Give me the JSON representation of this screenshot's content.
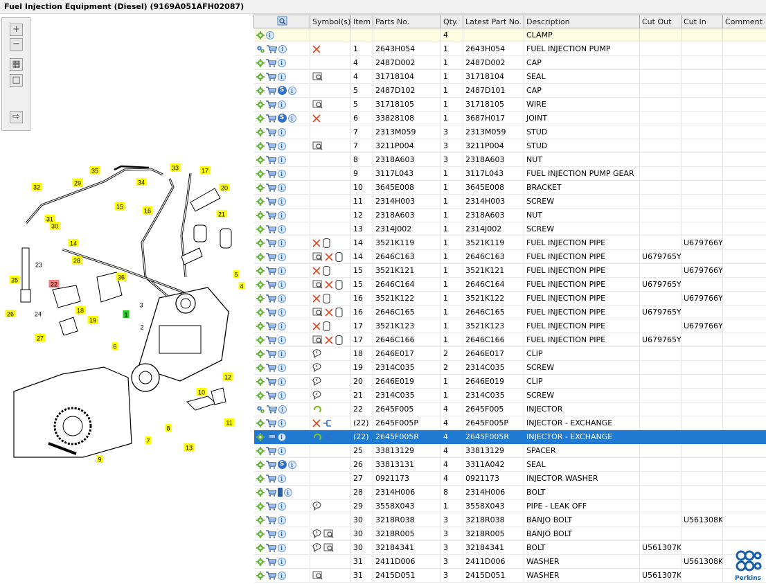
{
  "title": "Fuel Injection Equipment (Diesel) (9169A051AFH02087)",
  "toolbar": {
    "zoom_in": "+",
    "zoom_out": "−",
    "fit": "▦",
    "frame": "□",
    "export": "⇨"
  },
  "table": {
    "headers": [
      "",
      "Symbol(s)",
      "Item",
      "Parts No.",
      "Qty.",
      "Latest Part No.",
      "Description",
      "Cut Out",
      "Cut In",
      "Comment"
    ],
    "rows": [
      {
        "a": [
          "gear",
          "info"
        ],
        "s": [],
        "item": "",
        "part": "",
        "qty": "4",
        "latest": "",
        "desc": "CLAMP",
        "cutout": "",
        "cutin": "",
        "comment": ""
      },
      {
        "a": [
          "gears",
          "cart",
          "info"
        ],
        "s": [
          "x"
        ],
        "item": "1",
        "part": "2643H054",
        "qty": "1",
        "latest": "2643H054",
        "desc": "FUEL INJECTION PUMP",
        "cutout": "",
        "cutin": "",
        "comment": ""
      },
      {
        "a": [
          "gear",
          "cart",
          "info"
        ],
        "s": [],
        "item": "4",
        "part": "2487D002",
        "qty": "1",
        "latest": "2487D002",
        "desc": "CAP",
        "cutout": "",
        "cutin": "",
        "comment": ""
      },
      {
        "a": [
          "gear",
          "cart",
          "info"
        ],
        "s": [
          "view"
        ],
        "item": "4",
        "part": "31718104",
        "qty": "1",
        "latest": "31718104",
        "desc": "SEAL",
        "cutout": "",
        "cutin": "",
        "comment": ""
      },
      {
        "a": [
          "gear",
          "cart",
          "s",
          "info"
        ],
        "s": [],
        "item": "5",
        "part": "2487D102",
        "qty": "1",
        "latest": "2487D101",
        "desc": "CAP",
        "cutout": "",
        "cutin": "",
        "comment": ""
      },
      {
        "a": [
          "gear",
          "cart",
          "info"
        ],
        "s": [
          "view"
        ],
        "item": "5",
        "part": "31718105",
        "qty": "1",
        "latest": "31718105",
        "desc": "WIRE",
        "cutout": "",
        "cutin": "",
        "comment": ""
      },
      {
        "a": [
          "gear",
          "cart",
          "s",
          "info"
        ],
        "s": [
          "x"
        ],
        "item": "6",
        "part": "33828108",
        "qty": "1",
        "latest": "3687H017",
        "desc": "JOINT",
        "cutout": "",
        "cutin": "",
        "comment": ""
      },
      {
        "a": [
          "gear",
          "cart",
          "info"
        ],
        "s": [],
        "item": "7",
        "part": "2313M059",
        "qty": "3",
        "latest": "2313M059",
        "desc": "STUD",
        "cutout": "",
        "cutin": "",
        "comment": ""
      },
      {
        "a": [
          "gear",
          "cart",
          "info"
        ],
        "s": [
          "view"
        ],
        "item": "7",
        "part": "3211P004",
        "qty": "3",
        "latest": "3211P004",
        "desc": "STUD",
        "cutout": "",
        "cutin": "",
        "comment": ""
      },
      {
        "a": [
          "gear",
          "cart",
          "info"
        ],
        "s": [],
        "item": "8",
        "part": "2318A603",
        "qty": "3",
        "latest": "2318A603",
        "desc": "NUT",
        "cutout": "",
        "cutin": "",
        "comment": ""
      },
      {
        "a": [
          "gear",
          "cart",
          "info"
        ],
        "s": [],
        "item": "9",
        "part": "3117L043",
        "qty": "1",
        "latest": "3117L043",
        "desc": "FUEL INJECTION PUMP GEAR",
        "cutout": "",
        "cutin": "",
        "comment": ""
      },
      {
        "a": [
          "gear",
          "cart",
          "info"
        ],
        "s": [],
        "item": "10",
        "part": "3645E008",
        "qty": "1",
        "latest": "3645E008",
        "desc": "BRACKET",
        "cutout": "",
        "cutin": "",
        "comment": ""
      },
      {
        "a": [
          "gear",
          "cart",
          "info"
        ],
        "s": [],
        "item": "11",
        "part": "2314H003",
        "qty": "1",
        "latest": "2314H003",
        "desc": "SCREW",
        "cutout": "",
        "cutin": "",
        "comment": ""
      },
      {
        "a": [
          "gear",
          "cart",
          "info"
        ],
        "s": [],
        "item": "12",
        "part": "2318A603",
        "qty": "1",
        "latest": "2318A603",
        "desc": "NUT",
        "cutout": "",
        "cutin": "",
        "comment": ""
      },
      {
        "a": [
          "gear",
          "cart",
          "info"
        ],
        "s": [],
        "item": "13",
        "part": "2314J002",
        "qty": "1",
        "latest": "2314J002",
        "desc": "SCREW",
        "cutout": "",
        "cutin": "",
        "comment": ""
      },
      {
        "a": [
          "gear",
          "cart",
          "info"
        ],
        "s": [
          "x",
          "can"
        ],
        "item": "14",
        "part": "3521K119",
        "qty": "1",
        "latest": "3521K119",
        "desc": "FUEL INJECTION PIPE",
        "cutout": "",
        "cutin": "U679766Y",
        "comment": ""
      },
      {
        "a": [
          "gear",
          "cart",
          "info"
        ],
        "s": [
          "view",
          "x",
          "can"
        ],
        "item": "14",
        "part": "2646C163",
        "qty": "1",
        "latest": "2646C163",
        "desc": "FUEL INJECTION PIPE",
        "cutout": "U679765Y",
        "cutin": "",
        "comment": ""
      },
      {
        "a": [
          "gear",
          "cart",
          "info"
        ],
        "s": [
          "x",
          "can"
        ],
        "item": "15",
        "part": "3521K121",
        "qty": "1",
        "latest": "3521K121",
        "desc": "FUEL INJECTION PIPE",
        "cutout": "",
        "cutin": "U679766Y",
        "comment": ""
      },
      {
        "a": [
          "gear",
          "cart",
          "info"
        ],
        "s": [
          "view",
          "x",
          "can"
        ],
        "item": "15",
        "part": "2646C164",
        "qty": "1",
        "latest": "2646C164",
        "desc": "FUEL INJECTION PIPE",
        "cutout": "U679765Y",
        "cutin": "",
        "comment": ""
      },
      {
        "a": [
          "gear",
          "cart",
          "info"
        ],
        "s": [
          "x",
          "can"
        ],
        "item": "16",
        "part": "3521K122",
        "qty": "1",
        "latest": "3521K122",
        "desc": "FUEL INJECTION PIPE",
        "cutout": "",
        "cutin": "U679766Y",
        "comment": ""
      },
      {
        "a": [
          "gear",
          "cart",
          "info"
        ],
        "s": [
          "view",
          "x",
          "can"
        ],
        "item": "16",
        "part": "2646C165",
        "qty": "1",
        "latest": "2646C165",
        "desc": "FUEL INJECTION PIPE",
        "cutout": "U679765Y",
        "cutin": "",
        "comment": ""
      },
      {
        "a": [
          "gear",
          "cart",
          "info"
        ],
        "s": [
          "x",
          "can"
        ],
        "item": "17",
        "part": "3521K123",
        "qty": "1",
        "latest": "3521K123",
        "desc": "FUEL INJECTION PIPE",
        "cutout": "",
        "cutin": "U679766Y",
        "comment": ""
      },
      {
        "a": [
          "gear",
          "cart",
          "info"
        ],
        "s": [
          "view",
          "x",
          "can"
        ],
        "item": "17",
        "part": "2646C166",
        "qty": "1",
        "latest": "2646C166",
        "desc": "FUEL INJECTION PIPE",
        "cutout": "U679765Y",
        "cutin": "",
        "comment": ""
      },
      {
        "a": [
          "gear",
          "cart",
          "info"
        ],
        "s": [
          "bubble"
        ],
        "item": "18",
        "part": "2646E017",
        "qty": "2",
        "latest": "2646E017",
        "desc": "CLIP",
        "cutout": "",
        "cutin": "",
        "comment": ""
      },
      {
        "a": [
          "gear",
          "cart",
          "info"
        ],
        "s": [
          "bubble"
        ],
        "item": "19",
        "part": "2314C035",
        "qty": "2",
        "latest": "2314C035",
        "desc": "SCREW",
        "cutout": "",
        "cutin": "",
        "comment": ""
      },
      {
        "a": [
          "gear",
          "cart",
          "info"
        ],
        "s": [
          "bubble"
        ],
        "item": "20",
        "part": "2646E019",
        "qty": "1",
        "latest": "2646E019",
        "desc": "CLIP",
        "cutout": "",
        "cutin": "",
        "comment": ""
      },
      {
        "a": [
          "gear",
          "cart",
          "info"
        ],
        "s": [
          "bubble"
        ],
        "item": "21",
        "part": "2314C035",
        "qty": "1",
        "latest": "2314C035",
        "desc": "SCREW",
        "cutout": "",
        "cutin": "",
        "comment": ""
      },
      {
        "a": [
          "gears",
          "cart",
          "info"
        ],
        "s": [
          "recycle"
        ],
        "item": "22",
        "part": "2645F005",
        "qty": "4",
        "latest": "2645F005",
        "desc": "INJECTOR",
        "cutout": "",
        "cutin": "",
        "comment": ""
      },
      {
        "a": [
          "gear",
          "cart",
          "info"
        ],
        "s": [
          "x",
          "tree"
        ],
        "item": "(22)",
        "part": "2645F005P",
        "qty": "4",
        "latest": "2645F005P",
        "desc": "INJECTOR - EXCHANGE",
        "cutout": "",
        "cutin": "",
        "comment": ""
      },
      {
        "a": [
          "gear",
          "cart",
          "info"
        ],
        "s": [
          "recycle",
          "tree"
        ],
        "item": "(22)",
        "part": "2645F005R",
        "qty": "4",
        "latest": "2645F005R",
        "desc": "INJECTOR - EXCHANGE",
        "cutout": "",
        "cutin": "",
        "comment": "",
        "selected": true
      },
      {
        "a": [
          "gear",
          "cart",
          "info"
        ],
        "s": [],
        "item": "25",
        "part": "33813129",
        "qty": "4",
        "latest": "33813129",
        "desc": "SPACER",
        "cutout": "",
        "cutin": "",
        "comment": ""
      },
      {
        "a": [
          "gear",
          "cart",
          "s",
          "info"
        ],
        "s": [],
        "item": "26",
        "part": "33813131",
        "qty": "4",
        "latest": "3311A042",
        "desc": "SEAL",
        "cutout": "",
        "cutin": "",
        "comment": ""
      },
      {
        "a": [
          "gear",
          "cart",
          "info"
        ],
        "s": [],
        "item": "27",
        "part": "0921173",
        "qty": "4",
        "latest": "0921173",
        "desc": "INJECTOR WASHER",
        "cutout": "",
        "cutin": "",
        "comment": ""
      },
      {
        "a": [
          "gear",
          "cart",
          "book",
          "info"
        ],
        "s": [],
        "item": "28",
        "part": "2314H006",
        "qty": "8",
        "latest": "2314H006",
        "desc": "BOLT",
        "cutout": "",
        "cutin": "",
        "comment": ""
      },
      {
        "a": [
          "gear",
          "cart",
          "info"
        ],
        "s": [
          "bubble"
        ],
        "item": "29",
        "part": "3558X043",
        "qty": "1",
        "latest": "3558X043",
        "desc": "PIPE - LEAK OFF",
        "cutout": "",
        "cutin": "",
        "comment": ""
      },
      {
        "a": [
          "gear",
          "cart",
          "info"
        ],
        "s": [],
        "item": "30",
        "part": "3218R038",
        "qty": "3",
        "latest": "3218R038",
        "desc": "BANJO BOLT",
        "cutout": "",
        "cutin": "U561308K",
        "comment": ""
      },
      {
        "a": [
          "gear",
          "cart",
          "info"
        ],
        "s": [
          "bubble",
          "view"
        ],
        "item": "30",
        "part": "3218R005",
        "qty": "3",
        "latest": "3218R005",
        "desc": "BANJO BOLT",
        "cutout": "",
        "cutin": "",
        "comment": ""
      },
      {
        "a": [
          "gear",
          "cart",
          "info"
        ],
        "s": [
          "bubble",
          "view"
        ],
        "item": "30",
        "part": "32184341",
        "qty": "3",
        "latest": "32184341",
        "desc": "BOLT",
        "cutout": "U561307K",
        "cutin": "",
        "comment": ""
      },
      {
        "a": [
          "gear",
          "cart",
          "info"
        ],
        "s": [],
        "item": "31",
        "part": "2411D006",
        "qty": "3",
        "latest": "2411D006",
        "desc": "WASHER",
        "cutout": "",
        "cutin": "U561308K",
        "comment": ""
      },
      {
        "a": [
          "gear",
          "cart",
          "info"
        ],
        "s": [
          "view"
        ],
        "item": "31",
        "part": "2415D051",
        "qty": "3",
        "latest": "2415D051",
        "desc": "WASHER",
        "cutout": "U561307K",
        "cutin": "",
        "comment": ""
      }
    ]
  },
  "diagram": {
    "labels": [
      {
        "t": "35",
        "hl": "y"
      },
      {
        "t": "33",
        "hl": "y"
      },
      {
        "t": "17",
        "hl": "y"
      },
      {
        "t": "29",
        "hl": "y"
      },
      {
        "t": "34",
        "hl": "y"
      },
      {
        "t": "20",
        "hl": "y"
      },
      {
        "t": "32",
        "hl": "y"
      },
      {
        "t": "16",
        "hl": "y"
      },
      {
        "t": "15",
        "hl": "y"
      },
      {
        "t": "31",
        "hl": "y"
      },
      {
        "t": "30",
        "hl": "y"
      },
      {
        "t": "21",
        "hl": "y"
      },
      {
        "t": "14",
        "hl": "y"
      },
      {
        "t": "28",
        "hl": "y"
      },
      {
        "t": "23",
        "hl": "n"
      },
      {
        "t": "25",
        "hl": "y"
      },
      {
        "t": "22",
        "hl": "r"
      },
      {
        "t": "36",
        "hl": "y"
      },
      {
        "t": "5",
        "hl": "y"
      },
      {
        "t": "4",
        "hl": "y"
      },
      {
        "t": "3",
        "hl": "n"
      },
      {
        "t": "1",
        "hl": "g"
      },
      {
        "t": "2",
        "hl": "n"
      },
      {
        "t": "18",
        "hl": "y"
      },
      {
        "t": "26",
        "hl": "y"
      },
      {
        "t": "24",
        "hl": "n"
      },
      {
        "t": "19",
        "hl": "y"
      },
      {
        "t": "27",
        "hl": "y"
      },
      {
        "t": "6",
        "hl": "y"
      },
      {
        "t": "12",
        "hl": "y"
      },
      {
        "t": "10",
        "hl": "y"
      },
      {
        "t": "11",
        "hl": "y"
      },
      {
        "t": "8",
        "hl": "y"
      },
      {
        "t": "7",
        "hl": "y"
      },
      {
        "t": "13",
        "hl": "y"
      },
      {
        "t": "9",
        "hl": "y"
      }
    ]
  },
  "logo": {
    "brand": "Perkins",
    "color": "#1b5fa8"
  },
  "colors": {
    "selection": "#1f7ad2",
    "label_yellow": "#ffff00",
    "label_red": "#f08080",
    "label_green": "#22cc22",
    "x_mark": "#e0461e"
  }
}
